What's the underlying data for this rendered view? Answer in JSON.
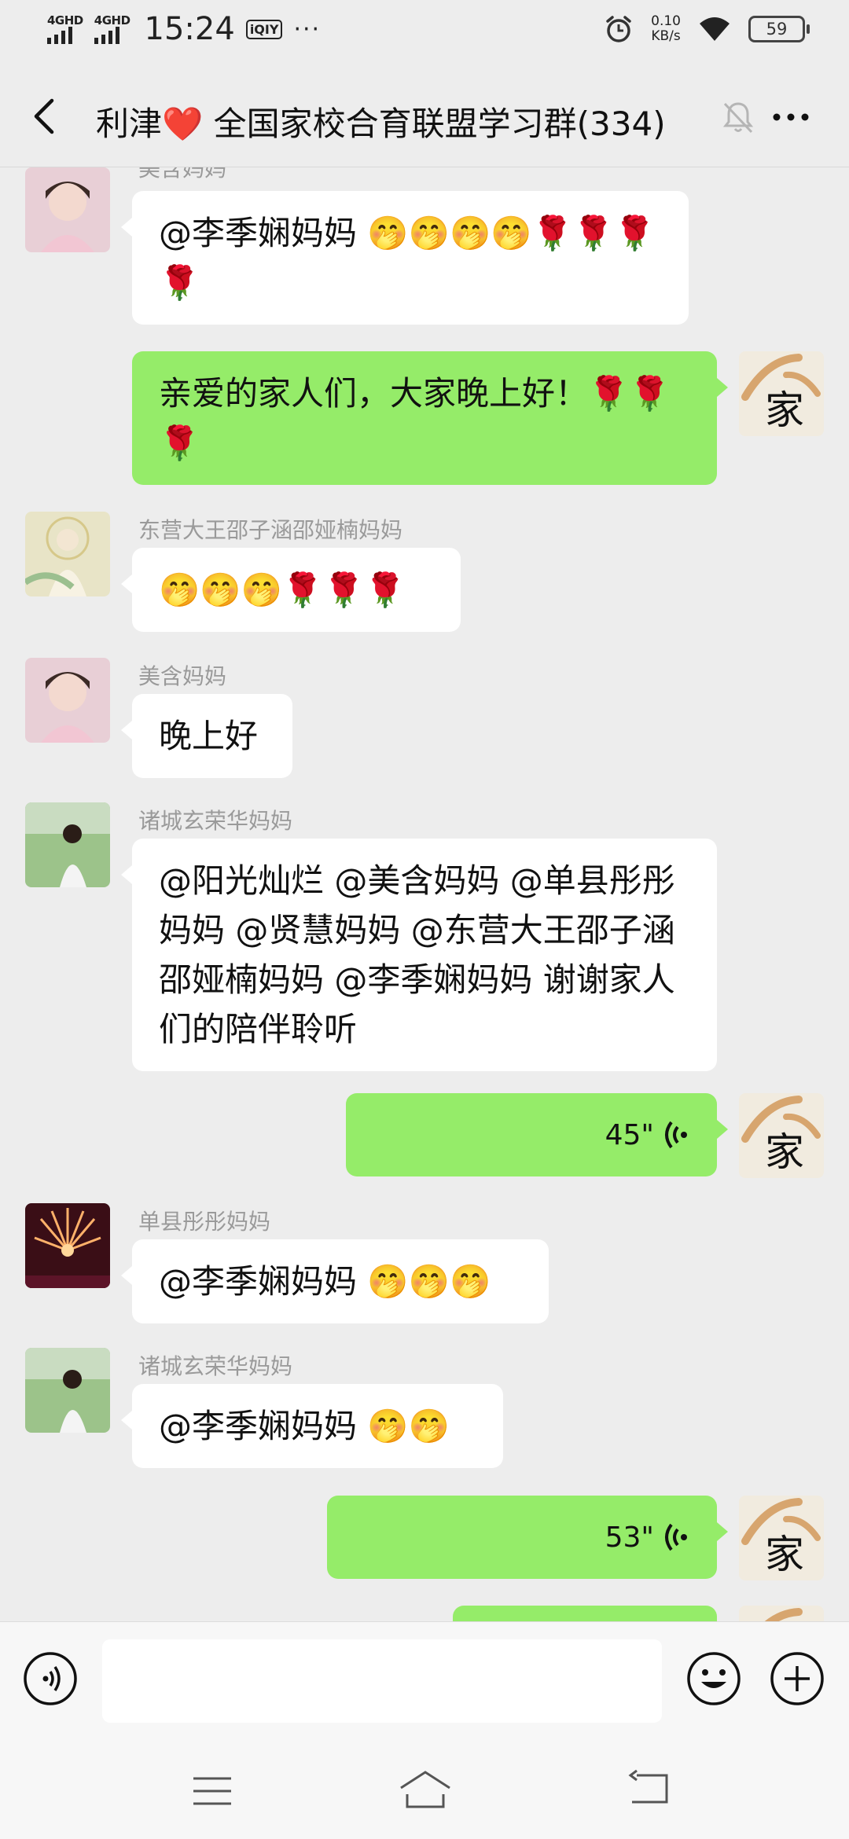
{
  "status_bar": {
    "network1": "4GHD",
    "network2": "4GHD",
    "time": "15:24",
    "app_badge": "iQIY",
    "more_dots": "···",
    "speed_value": "0.10",
    "speed_unit": "KB/s",
    "battery": "59"
  },
  "header": {
    "title_prefix": "利津",
    "title_heart": "❤️",
    "title_main": " 全国家校合育联盟学习群(334)"
  },
  "messages": [
    {
      "sender": "美含妈妈",
      "text": "@李季娴妈妈 🤭🤭🤭🤭🌹🌹🌹🌹"
    },
    {
      "text": "亲爱的家人们，大家晚上好！🌹🌹🌹"
    },
    {
      "sender": "东营大王邵子涵邵娅楠妈妈",
      "text": "🤭🤭🤭🌹🌹🌹"
    },
    {
      "sender": "美含妈妈",
      "text": "晚上好"
    },
    {
      "sender": "诸城玄荣华妈妈",
      "text": "@阳光灿烂 @美含妈妈 @单县彤彤妈妈 @贤慧妈妈 @东营大王邵子涵邵娅楠妈妈 @李季娴妈妈 谢谢家人们的陪伴聆听"
    },
    {
      "duration": "45\""
    },
    {
      "sender": "单县彤彤妈妈",
      "text": "@李季娴妈妈 🤭🤭🤭"
    },
    {
      "sender": "诸城玄荣华妈妈",
      "text": "@李季娴妈妈 🤭🤭"
    },
    {
      "duration": "53\""
    }
  ],
  "my_avatar_char": "家",
  "colors": {
    "background": "#ededed",
    "bubble_out": "#95ec69",
    "bubble_in": "#ffffff",
    "sender": "#9a9a9a"
  }
}
